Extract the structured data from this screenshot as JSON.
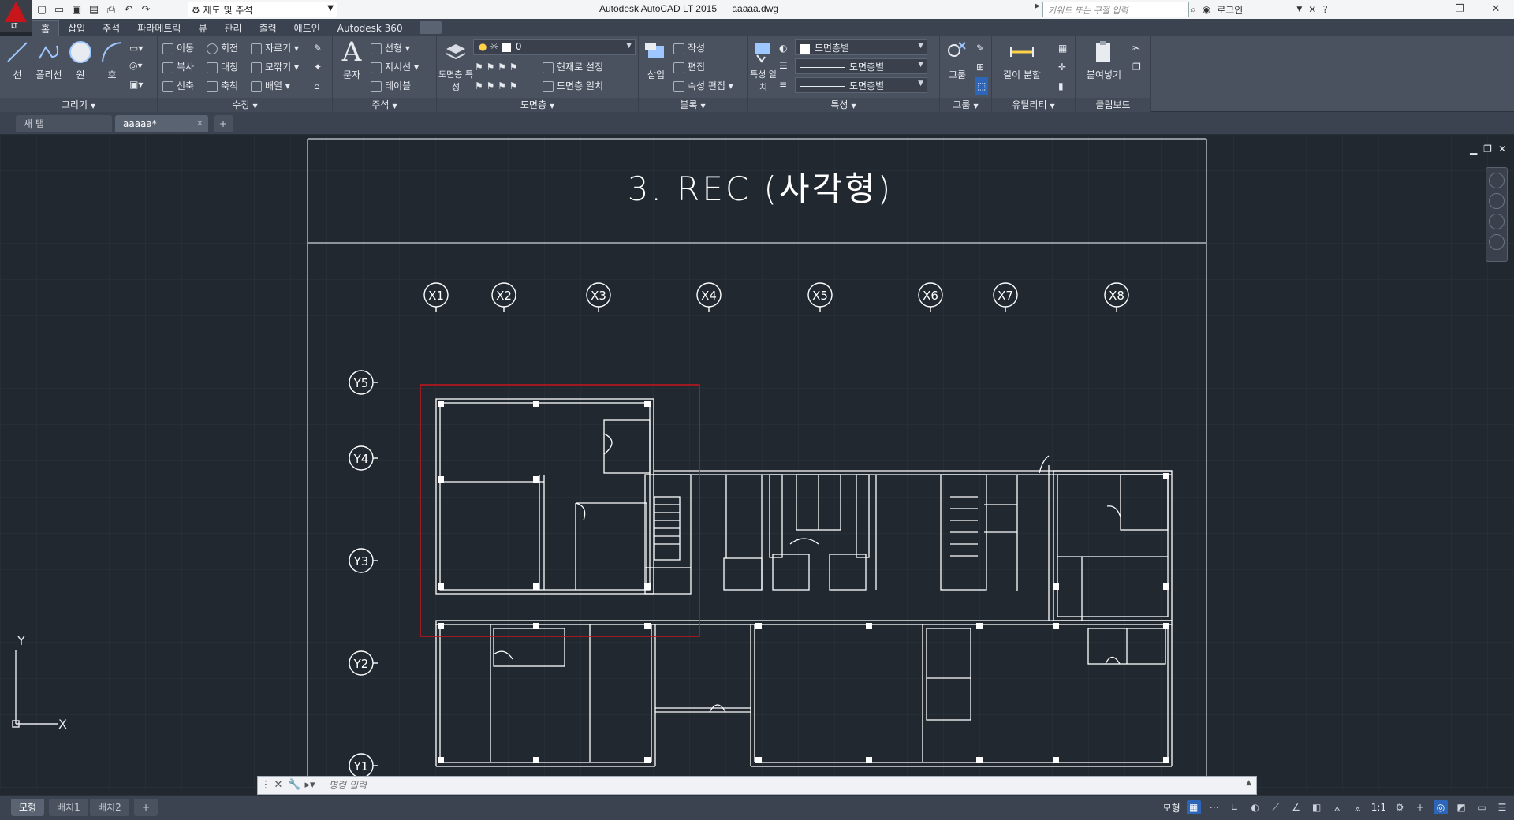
{
  "window": {
    "app_title": "Autodesk AutoCAD LT 2015",
    "file_name": "aaaaa.dwg",
    "logo_label": "LT",
    "workspace": "제도 및 주석",
    "search_placeholder": "키워드 또는 구절 입력",
    "login_label": "로그인"
  },
  "ribbon_tabs": [
    "홈",
    "삽입",
    "주석",
    "파라메트릭",
    "뷰",
    "관리",
    "출력",
    "애드인",
    "Autodesk 360"
  ],
  "panels": {
    "draw": {
      "title": "그리기",
      "line": "선",
      "polyline": "폴리선",
      "circle": "원",
      "arc": "호"
    },
    "modify": {
      "title": "수정",
      "move": "이동",
      "rotate": "회전",
      "trim": "자르기",
      "copy": "복사",
      "mirror": "대칭",
      "fillet": "모깎기",
      "stretch": "신축",
      "scale": "축척",
      "array": "배열"
    },
    "annotation": {
      "title": "주석",
      "text": "문자",
      "linear": "선형",
      "leader": "지시선",
      "table": "테이블"
    },
    "layers": {
      "title": "도면층",
      "properties": "도면층 특성",
      "current_layer": "0",
      "make_current": "현재로 설정",
      "match_layer": "도면층 일치"
    },
    "block": {
      "title": "블록",
      "insert": "삽입",
      "create": "작성",
      "edit": "편집",
      "edit_attributes": "속성 편집"
    },
    "properties": {
      "title": "특성",
      "match": "특성 일치",
      "color": "도면층별",
      "linetype": "도면층별",
      "lineweight": "도면층별"
    },
    "groups": {
      "title": "그룹",
      "group": "그룹"
    },
    "utilities": {
      "title": "유틸리티",
      "measure": "길이 분할"
    },
    "clipboard": {
      "title": "클립보드",
      "paste": "붙여넣기"
    }
  },
  "doc_tabs": {
    "new_tab": "새 탭",
    "active": "aaaaa*"
  },
  "drawing": {
    "title": "3. REC (사각형)",
    "x_grid": [
      "X1",
      "X2",
      "X3",
      "X4",
      "X5",
      "X6",
      "X7",
      "X8"
    ],
    "y_grid": [
      "Y5",
      "Y4",
      "Y3",
      "Y2",
      "Y1"
    ],
    "ucs_x": "X",
    "ucs_y": "Y",
    "selection_color": "#c8151b",
    "line_color": "#ffffff",
    "background": "#212830"
  },
  "command_line": {
    "placeholder": "명령 입력"
  },
  "layout_tabs": [
    "모형",
    "배치1",
    "배치2"
  ],
  "status": {
    "model_label": "모형",
    "scale": "1:1"
  }
}
